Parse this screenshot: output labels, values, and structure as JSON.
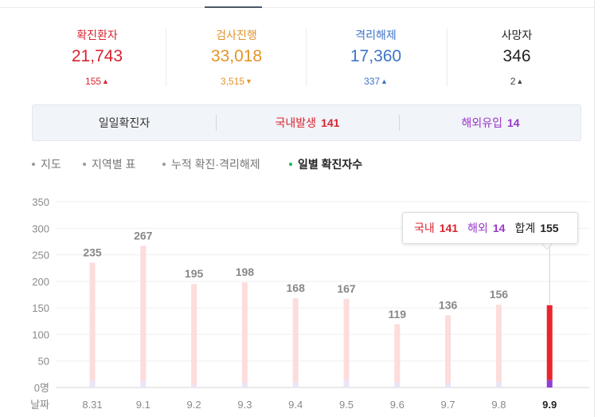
{
  "stats": [
    {
      "label": "확진환자",
      "value": "21,743",
      "delta": "155",
      "direction": "up",
      "color": "#d7242f"
    },
    {
      "label": "검사진행",
      "value": "33,018",
      "delta": "3,515",
      "direction": "down",
      "color": "#e4942a"
    },
    {
      "label": "격리해제",
      "value": "17,360",
      "delta": "337",
      "direction": "up",
      "color": "#3f74c9"
    },
    {
      "label": "사망자",
      "value": "346",
      "delta": "2",
      "direction": "up",
      "color": "#222222"
    }
  ],
  "arrows": {
    "up": "▲",
    "down": "▼"
  },
  "summary": {
    "title": "일일확진자",
    "domestic_label": "국내발생",
    "domestic_value": "141",
    "overseas_label": "해외유입",
    "overseas_value": "14",
    "domestic_color": "#d7242f",
    "overseas_color": "#9a37c9"
  },
  "subtabs": [
    {
      "label": "지도",
      "active": false
    },
    {
      "label": "지역별 표",
      "active": false
    },
    {
      "label": "누적 확진·격리해제",
      "active": false
    },
    {
      "label": "일별 확진자수",
      "active": true
    }
  ],
  "tooltip": {
    "domestic_key": "국내",
    "domestic_value": "141",
    "overseas_key": "해외",
    "overseas_value": "14",
    "total_key": "합계",
    "total_value": "155"
  },
  "chart_data": {
    "type": "bar",
    "categories": [
      "8.31",
      "9.1",
      "9.2",
      "9.3",
      "9.4",
      "9.5",
      "9.6",
      "9.7",
      "9.8",
      "9.9"
    ],
    "series": [
      {
        "name": "국내",
        "values": [
          222,
          255,
          190,
          189,
          158,
          152,
          110,
          127,
          145,
          141
        ],
        "color": "#fddcdc",
        "highlight_color": "#e8242c"
      },
      {
        "name": "해외",
        "values": [
          13,
          12,
          5,
          9,
          10,
          15,
          9,
          9,
          11,
          14
        ],
        "color": "#ece4f7",
        "highlight_color": "#8e3ed6"
      }
    ],
    "totals": [
      235,
      267,
      195,
      198,
      168,
      167,
      119,
      136,
      156,
      155
    ],
    "show_total_labels": [
      true,
      true,
      true,
      true,
      true,
      true,
      true,
      true,
      true,
      false
    ],
    "highlight_index": 9,
    "yticks": [
      "0명",
      "50",
      "100",
      "150",
      "200",
      "250",
      "300",
      "350"
    ],
    "ylim": [
      0,
      350
    ],
    "xlabel": "날짜",
    "grid": true
  }
}
